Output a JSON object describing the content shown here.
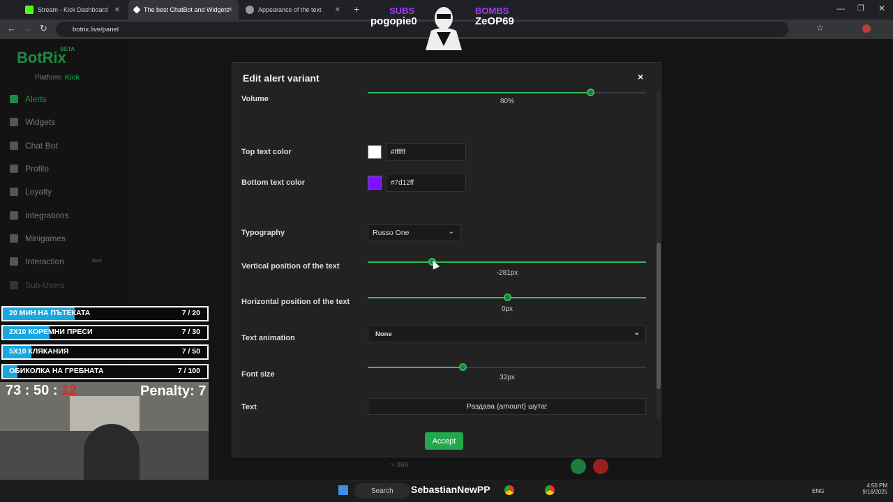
{
  "browser": {
    "tabs": [
      {
        "label": "Stream - Kick Dashboard"
      },
      {
        "label": "The best ChatBot and Widgets"
      },
      {
        "label": "Appearance of the text"
      }
    ],
    "url": "botrix.live/panel"
  },
  "sidebar": {
    "logo": "BotRix",
    "beta": "BETA",
    "platform_label": "Platform:",
    "platform_value": "Kick",
    "items": [
      {
        "label": "Alerts"
      },
      {
        "label": "Widgets"
      },
      {
        "label": "Chat Bot"
      },
      {
        "label": "Profile"
      },
      {
        "label": "Loyalty"
      },
      {
        "label": "Integrations"
      },
      {
        "label": "Minigames"
      },
      {
        "label": "Interaction",
        "badge": "NEW"
      },
      {
        "label": "Sub-Users"
      }
    ]
  },
  "background": {
    "bottom_value": "> 999"
  },
  "modal": {
    "title": "Edit alert variant",
    "close": "×",
    "volume": {
      "label": "Volume",
      "value": "80%",
      "level": 0.8
    },
    "top_text_color": {
      "label": "Top text color",
      "hex": "#ffffff",
      "color": "#ffffff"
    },
    "bottom_text_color": {
      "label": "Bottom text color",
      "hex": "#7d12ff",
      "color": "#7d12ff"
    },
    "typography": {
      "label": "Typography",
      "value": "Russo One"
    },
    "vertical_position": {
      "label": "Vertical position of the text",
      "value": "-281px",
      "level": 0.23
    },
    "horizontal_position": {
      "label": "Horizontal position of the text",
      "value": "0px",
      "level": 0.5
    },
    "text_animation": {
      "label": "Text animation",
      "value": "None"
    },
    "font_size": {
      "label": "Font size",
      "value": "32px",
      "level": 0.34
    },
    "text": {
      "label": "Text",
      "value": "Раздава {amount} шута!"
    },
    "accept": "Accept"
  },
  "overlay": {
    "subs_label": "SUBS",
    "subs_value": "pogopie0",
    "bombs_label": "BOMBS",
    "bombs_value": "ZeOP69",
    "goals": [
      {
        "name": "20 МИН НА ПЪТЕКАТА",
        "count": "7 / 20",
        "progress": 0.35
      },
      {
        "name": "2Х10 КОРЕМНИ ПРЕСИ",
        "count": "7 / 30",
        "progress": 0.23
      },
      {
        "name": "5Х10 КЛЯКАНИЯ",
        "count": "7 / 50",
        "progress": 0.14
      },
      {
        "name": "ОБИКОЛКА НА ГРЕБНАТА",
        "count": "7 / 100",
        "progress": 0.07
      }
    ],
    "timer_main": "73 : 50 : ",
    "timer_red": "12",
    "penalty": "Penalty: 7"
  },
  "taskbar": {
    "search": "Search",
    "overlay_name": "SebastianNewPP",
    "lang": "ENG",
    "time": "4:50 PM",
    "date": "9/16/2025"
  }
}
